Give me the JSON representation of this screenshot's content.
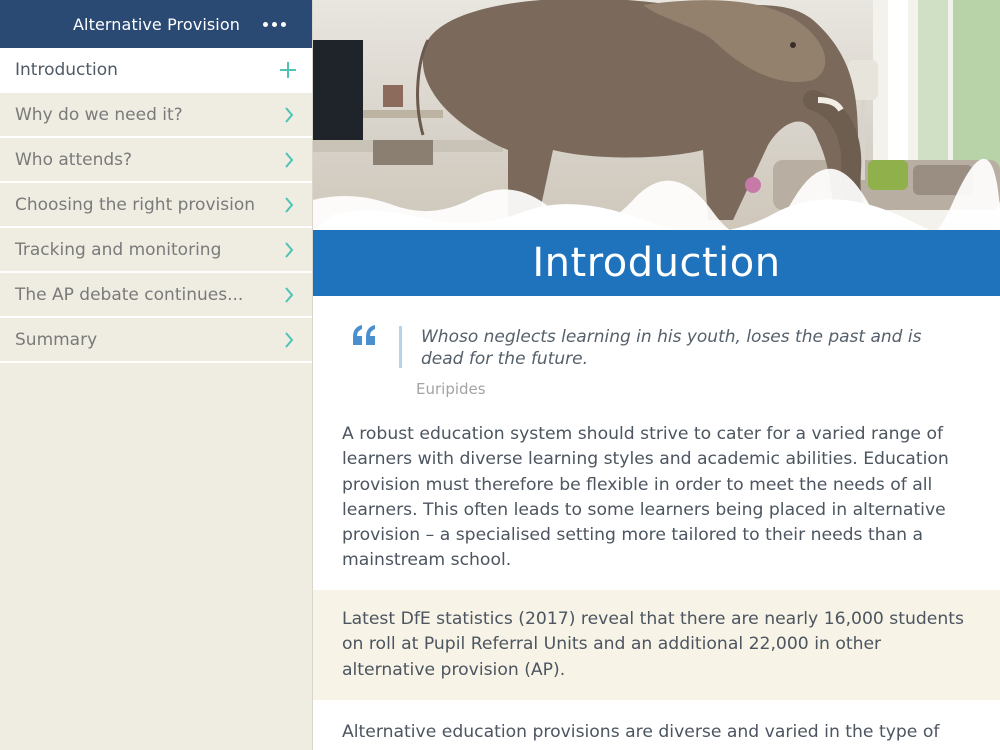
{
  "sidebar": {
    "title": "Alternative Provision",
    "items": [
      {
        "label": "Introduction",
        "active": true
      },
      {
        "label": "Why do we need it?"
      },
      {
        "label": "Who attends?"
      },
      {
        "label": "Choosing the right provision"
      },
      {
        "label": "Tracking and monitoring"
      },
      {
        "label": "The AP debate continues..."
      },
      {
        "label": "Summary"
      }
    ]
  },
  "main": {
    "title": "Introduction",
    "quote": {
      "text": "Whoso neglects learning in his youth, loses the past and is dead for the future.",
      "author": "Euripides"
    },
    "paragraphs": [
      "A robust education system should strive to cater for a varied range of learners with diverse learning styles and academic abilities. Education provision must therefore be flexible in order to meet the needs of all learners. This often leads to some learners being placed in alternative provision – a specialised setting more tailored to their needs than a mainstream school.",
      "Latest DfE statistics (2017) reveal that there are nearly 16,000 students on roll at Pupil Referral Units and an additional 22,000 in other alternative provision (AP).",
      "Alternative education provisions are diverse and varied in the type of"
    ]
  },
  "colors": {
    "header_navy": "#2a4a73",
    "accent_teal": "#4fc3b6",
    "title_blue": "#1f73bd",
    "sidebar_bg": "#efece2",
    "highlight_bg": "#f7f3e6"
  },
  "icons": {
    "more": "more-horizontal-icon",
    "expand": "plus-icon",
    "chevron": "chevron-right-icon",
    "quote": "quote-icon"
  }
}
